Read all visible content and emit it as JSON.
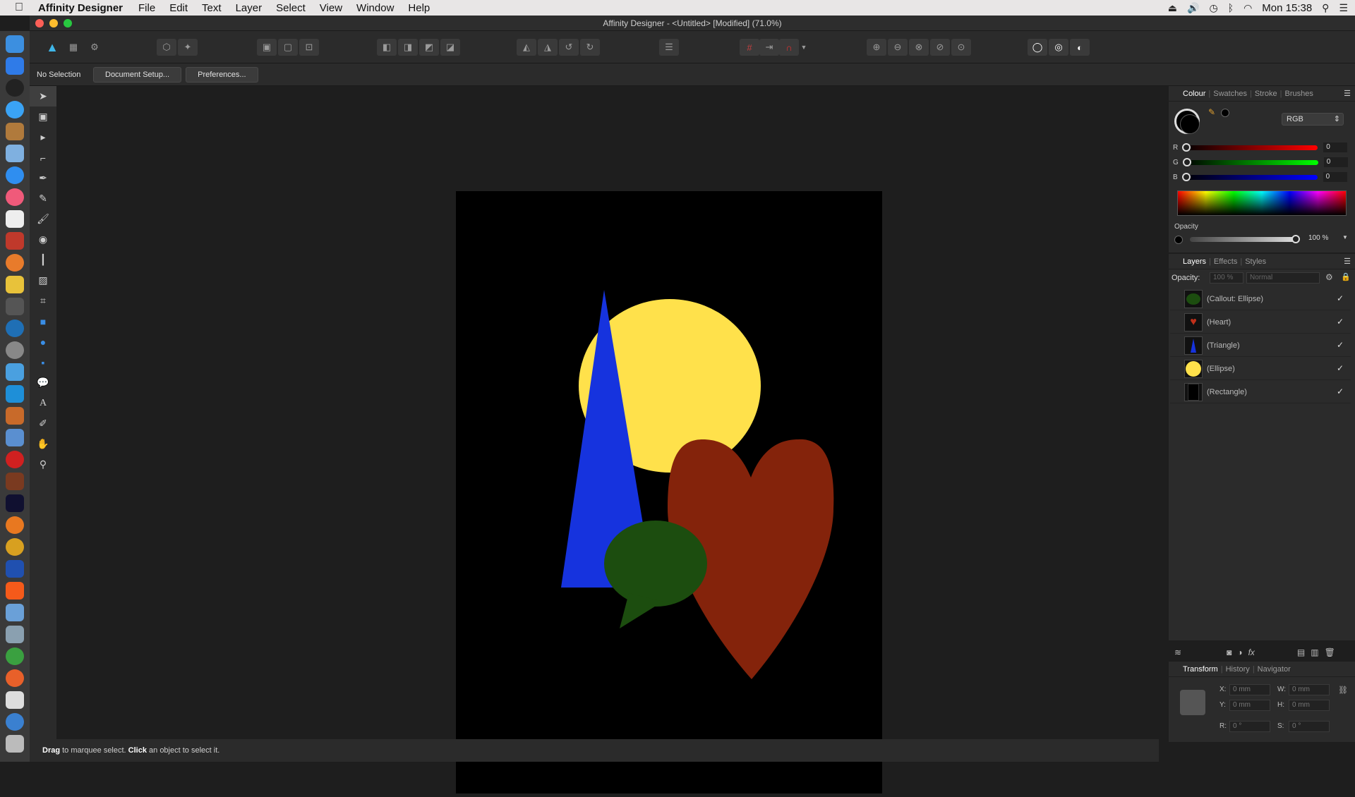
{
  "menubar": {
    "app_name": "Affinity Designer",
    "items": [
      "File",
      "Edit",
      "Text",
      "Layer",
      "Select",
      "View",
      "Window",
      "Help"
    ],
    "clock": "Mon 15:38"
  },
  "window": {
    "title": "Affinity Designer - <Untitled> [Modified] (71.0%)"
  },
  "context": {
    "selection": "No Selection",
    "document_setup": "Document Setup...",
    "preferences": "Preferences..."
  },
  "status": {
    "drag": "Drag",
    "text1": " to marquee select. ",
    "click": "Click",
    "text2": " an object to select it."
  },
  "colour_panel": {
    "tabs": [
      "Colour",
      "Swatches",
      "Stroke",
      "Brushes"
    ],
    "mode": "RGB",
    "r_label": "R",
    "r_value": "0",
    "g_label": "G",
    "g_value": "0",
    "b_label": "B",
    "b_value": "0",
    "opacity_label": "Opacity",
    "opacity_value": "100 %"
  },
  "layers_panel": {
    "tabs": [
      "Layers",
      "Effects",
      "Styles"
    ],
    "opacity_label": "Opacity:",
    "opacity_value": "100 %",
    "blend_mode": "Normal",
    "layers": [
      {
        "name": "(Callout: Ellipse)",
        "color": "#1c4d0f",
        "check": "✓"
      },
      {
        "name": "(Heart)",
        "color": "#84230b",
        "check": "✓"
      },
      {
        "name": "(Triangle)",
        "color": "#1633de",
        "check": "✓"
      },
      {
        "name": "(Ellipse)",
        "color": "#ffe14b",
        "check": "✓"
      },
      {
        "name": "(Rectangle)",
        "color": "#000000",
        "check": "✓"
      }
    ]
  },
  "transform_panel": {
    "tabs": [
      "Transform",
      "History",
      "Navigator"
    ],
    "x_label": "X:",
    "x_value": "0 mm",
    "y_label": "Y:",
    "y_value": "0 mm",
    "w_label": "W:",
    "w_value": "0 mm",
    "h_label": "H:",
    "h_value": "0 mm",
    "r_label": "R:",
    "r_value": "0 °",
    "s_label": "S:",
    "s_value": "0 °"
  },
  "canvas_shapes": {
    "yellow": "#ffe14b",
    "blue": "#1633de",
    "red": "#84230b",
    "green": "#1c4d0f"
  }
}
